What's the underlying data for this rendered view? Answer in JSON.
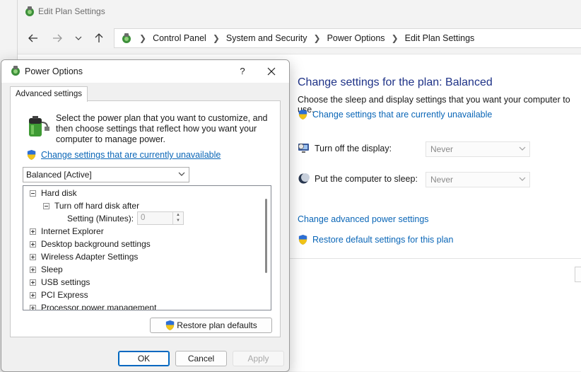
{
  "window": {
    "title": "Edit Plan Settings",
    "breadcrumb": [
      "Control Panel",
      "System and Security",
      "Power Options",
      "Edit Plan Settings"
    ]
  },
  "main": {
    "heading": "Change settings for the plan: Balanced",
    "description": "Choose the sleep and display settings that you want your computer to use.",
    "unavailable_link": "Change settings that are currently unavailable",
    "display_label": "Turn off the display:",
    "display_value": "Never",
    "sleep_label": "Put the computer to sleep:",
    "sleep_value": "Never",
    "advanced_link": "Change advanced power settings",
    "restore_link": "Restore default settings for this plan"
  },
  "dialog": {
    "title": "Power Options",
    "help": "?",
    "tab": "Advanced settings",
    "intro": "Select the power plan that you want to customize, and then choose settings that reflect how you want your computer to manage power.",
    "unavailable_link": "Change settings that are currently unavailable",
    "plan": "Balanced [Active]",
    "tree": {
      "hard_disk": "Hard disk",
      "turn_off_after": "Turn off hard disk after",
      "setting_label": "Setting (Minutes):",
      "setting_value": "0",
      "items": [
        "Internet Explorer",
        "Desktop background settings",
        "Wireless Adapter Settings",
        "Sleep",
        "USB settings",
        "PCI Express",
        "Processor power management"
      ]
    },
    "restore_button": "Restore plan defaults",
    "ok": "OK",
    "cancel": "Cancel",
    "apply": "Apply"
  },
  "colors": {
    "heading": "#1e3287",
    "link": "#0a66b7",
    "accent": "#0067c0"
  }
}
